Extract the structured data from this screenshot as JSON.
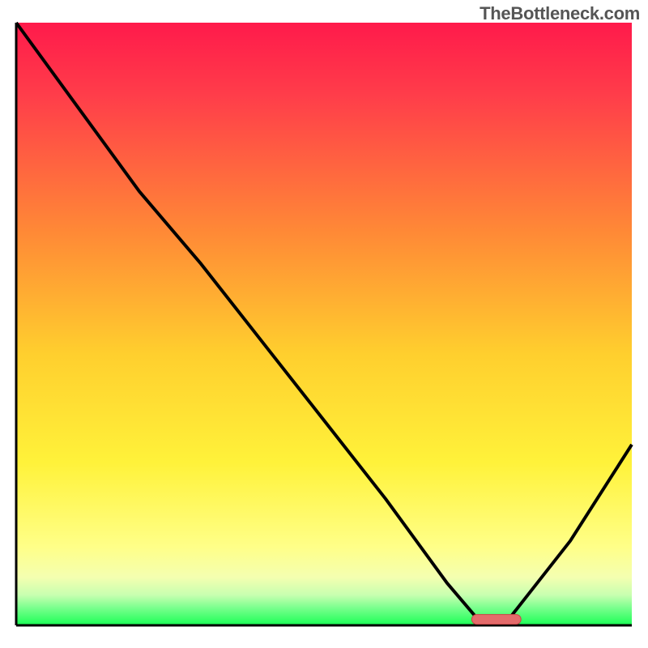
{
  "attribution": "TheBottleneck.com",
  "colors": {
    "curve": "#000000",
    "marker_fill": "#e46b6b",
    "marker_stroke": "#c74545",
    "axis": "#000000"
  },
  "chart_data": {
    "type": "line",
    "title": "",
    "xlabel": "",
    "ylabel": "",
    "xlim": [
      0,
      100
    ],
    "ylim": [
      0,
      100
    ],
    "legend": false,
    "grid": false,
    "series": [
      {
        "name": "bottleneck-curve",
        "x": [
          0,
          10,
          20,
          30,
          40,
          50,
          60,
          70,
          75,
          80,
          90,
          100
        ],
        "y": [
          100,
          86,
          72,
          60,
          47,
          34,
          21,
          7,
          1,
          1,
          14,
          30
        ]
      }
    ],
    "marker": {
      "name": "optimal-range",
      "x_start": 74,
      "x_end": 82,
      "y": 1
    },
    "_note": "y values are read from the gradient background; color maps y≈100→red(top), y≈0→green(bottom). Values estimated to nearest ~1–2 units from pixel positions."
  }
}
